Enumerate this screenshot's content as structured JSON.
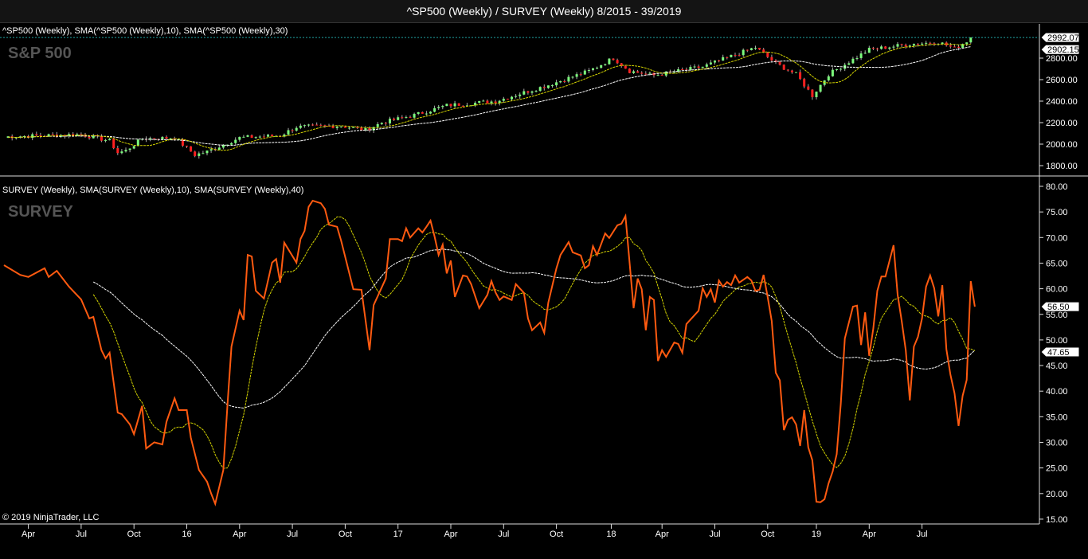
{
  "window_title": "^SP500 (Weekly) / SURVEY (Weekly)  8/2015 - 39/2019",
  "copyright": "© 2019 NinjaTrader, LLC",
  "chart_data": [
    {
      "type": "candlestick",
      "panel_header": "^SP500 (Weekly), SMA(^SP500 (Weekly),10), SMA(^SP500 (Weekly),30)",
      "panel_label": "S&P 500",
      "x_unit": "weeks since start",
      "y_ticks": [
        "1800.00",
        "2000.00",
        "2200.00",
        "2400.00",
        "2600.00",
        "2800.00"
      ],
      "y_tick_values": [
        1800,
        2000,
        2200,
        2400,
        2600,
        2800
      ],
      "ylim": [
        1720,
        3010
      ],
      "last_price_value": 2992.07,
      "last_price_label": "2992.07",
      "sma_value": 2902.15,
      "sma_label": "2902.15",
      "close_anchors": [
        [
          0,
          2060
        ],
        [
          1,
          2070
        ],
        [
          19,
          2090
        ],
        [
          26,
          2030
        ],
        [
          28,
          1920
        ],
        [
          30,
          1940
        ],
        [
          34,
          2050
        ],
        [
          42,
          2060
        ],
        [
          47,
          1900
        ],
        [
          50,
          1930
        ],
        [
          58,
          2060
        ],
        [
          68,
          2080
        ],
        [
          72,
          2160
        ],
        [
          83,
          2170
        ],
        [
          89,
          2130
        ],
        [
          93,
          2200
        ],
        [
          101,
          2270
        ],
        [
          109,
          2360
        ],
        [
          121,
          2400
        ],
        [
          134,
          2550
        ],
        [
          144,
          2680
        ],
        [
          150,
          2800
        ],
        [
          154,
          2680
        ],
        [
          160,
          2640
        ],
        [
          172,
          2720
        ],
        [
          185,
          2900
        ],
        [
          190,
          2750
        ],
        [
          195,
          2650
        ],
        [
          199,
          2450
        ],
        [
          203,
          2650
        ],
        [
          213,
          2880
        ],
        [
          223,
          2930
        ],
        [
          230,
          2950
        ],
        [
          234,
          2890
        ],
        [
          238,
          2980
        ]
      ],
      "sma_periods": [
        10,
        30
      ],
      "colors": {
        "up": "#7CFC7C",
        "down": "#ff2020",
        "sma10": "#d4d400",
        "sma30": "#ffffff",
        "price_line": "#20a0a0"
      }
    },
    {
      "type": "line",
      "panel_header": "SURVEY (Weekly), SMA(SURVEY (Weekly),10), SMA(SURVEY (Weekly),40)",
      "panel_label": "SURVEY",
      "x_unit": "weeks since start",
      "y_ticks": [
        "15.00",
        "20.00",
        "25.00",
        "30.00",
        "35.00",
        "40.00",
        "45.00",
        "50.00",
        "55.00",
        "60.00",
        "65.00",
        "70.00",
        "75.00",
        "80.00"
      ],
      "y_tick_values": [
        15,
        20,
        25,
        30,
        35,
        40,
        45,
        50,
        55,
        60,
        65,
        70,
        75,
        80
      ],
      "ylim": [
        15,
        80
      ],
      "last_value_label": "56.50",
      "last_value": 56.5,
      "sma_label": "47.65",
      "sma_value": 47.65,
      "sma_periods": [
        10,
        40
      ],
      "colors": {
        "line": "#ff5a10",
        "sma10": "#d4d400",
        "sma40": "#ffffff"
      },
      "points": [
        [
          0,
          64.6
        ],
        [
          4,
          62.7
        ],
        [
          6,
          62.3
        ],
        [
          10,
          64
        ],
        [
          11,
          62.3
        ],
        [
          13,
          63.5
        ],
        [
          16,
          60.4
        ],
        [
          19,
          57.9
        ],
        [
          21,
          54.2
        ],
        [
          22,
          54.5
        ],
        [
          24,
          48
        ],
        [
          25,
          46.4
        ],
        [
          26,
          47.5
        ],
        [
          28,
          35.8
        ],
        [
          29,
          35.5
        ],
        [
          31,
          33.5
        ],
        [
          32,
          31.6
        ],
        [
          34,
          37.1
        ],
        [
          35,
          28.8
        ],
        [
          37,
          30
        ],
        [
          39,
          29.6
        ],
        [
          40,
          34
        ],
        [
          42,
          38.6
        ],
        [
          43,
          36.3
        ],
        [
          45,
          36.3
        ],
        [
          46,
          30.9
        ],
        [
          48,
          24.6
        ],
        [
          50,
          22.3
        ],
        [
          51,
          20
        ],
        [
          52,
          18
        ],
        [
          54,
          24.6
        ],
        [
          55,
          37.1
        ],
        [
          56,
          48.7
        ],
        [
          58,
          55.7
        ],
        [
          59,
          53.9
        ],
        [
          60,
          66.6
        ],
        [
          61,
          66.3
        ],
        [
          62,
          59.6
        ],
        [
          64,
          58.1
        ],
        [
          66,
          65.1
        ],
        [
          67,
          65.8
        ],
        [
          68,
          61.2
        ],
        [
          69,
          69
        ],
        [
          72,
          65.1
        ],
        [
          73,
          69.7
        ],
        [
          74,
          71.3
        ],
        [
          75,
          76
        ],
        [
          76,
          77.2
        ],
        [
          78,
          76.7
        ],
        [
          79,
          75.6
        ],
        [
          80,
          72.5
        ],
        [
          82,
          72.1
        ],
        [
          83,
          69.4
        ],
        [
          86,
          59.9
        ],
        [
          88,
          59.8
        ],
        [
          90,
          48
        ],
        [
          91,
          56.8
        ],
        [
          94,
          62
        ],
        [
          95,
          69.7
        ],
        [
          97,
          69.7
        ],
        [
          98,
          69.3
        ],
        [
          99,
          71.8
        ],
        [
          100,
          70
        ],
        [
          102,
          71.8
        ],
        [
          103,
          71
        ],
        [
          104,
          72.1
        ],
        [
          105,
          73.3
        ],
        [
          106,
          70.2
        ],
        [
          107,
          66.6
        ],
        [
          108,
          68.6
        ],
        [
          109,
          63
        ],
        [
          110,
          65.5
        ],
        [
          111,
          58.4
        ],
        [
          113,
          62.6
        ],
        [
          114,
          62.4
        ],
        [
          115,
          60.9
        ],
        [
          117,
          56.2
        ],
        [
          119,
          58.8
        ],
        [
          120,
          61.5
        ],
        [
          121,
          59.3
        ],
        [
          122,
          57.8
        ],
        [
          123,
          58.5
        ],
        [
          125,
          57.8
        ],
        [
          126,
          60.9
        ],
        [
          128,
          59.2
        ],
        [
          129,
          54.2
        ],
        [
          130,
          51.9
        ],
        [
          132,
          53.4
        ],
        [
          133,
          51.4
        ],
        [
          134,
          57.3
        ],
        [
          136,
          64
        ],
        [
          137,
          66.6
        ],
        [
          139,
          69.1
        ],
        [
          140,
          67.1
        ],
        [
          142,
          66.5
        ],
        [
          143,
          64
        ],
        [
          144,
          64.6
        ],
        [
          145,
          68.3
        ],
        [
          146,
          66.6
        ],
        [
          148,
          70.8
        ],
        [
          149,
          69.9
        ],
        [
          151,
          72.4
        ],
        [
          152,
          72.7
        ],
        [
          153,
          74.2
        ],
        [
          155,
          56.2
        ],
        [
          156,
          62
        ],
        [
          157,
          59.9
        ],
        [
          158,
          51.9
        ],
        [
          159,
          58.4
        ],
        [
          160,
          57.8
        ],
        [
          161,
          45.9
        ],
        [
          162,
          48
        ],
        [
          163,
          46.7
        ],
        [
          165,
          49.5
        ],
        [
          166,
          49.2
        ],
        [
          167,
          47.5
        ],
        [
          168,
          53.1
        ],
        [
          171,
          55.7
        ],
        [
          172,
          60.1
        ],
        [
          173,
          58.4
        ],
        [
          174,
          59.9
        ],
        [
          175,
          57.3
        ],
        [
          176,
          61.6
        ],
        [
          177,
          60.4
        ],
        [
          178,
          61.3
        ],
        [
          179,
          60.7
        ],
        [
          180,
          62.6
        ],
        [
          181,
          61.2
        ],
        [
          183,
          62.3
        ],
        [
          184,
          61.6
        ],
        [
          185,
          59.6
        ],
        [
          186,
          59.8
        ],
        [
          187,
          62.7
        ],
        [
          188,
          58.4
        ],
        [
          189,
          53.7
        ],
        [
          190,
          43.6
        ],
        [
          191,
          42.1
        ],
        [
          192,
          32.4
        ],
        [
          193,
          34.4
        ],
        [
          194,
          34.9
        ],
        [
          195,
          33.5
        ],
        [
          196,
          29.3
        ],
        [
          197,
          36.3
        ],
        [
          198,
          29
        ],
        [
          199,
          26.5
        ],
        [
          200,
          18.4
        ],
        [
          201,
          18.3
        ],
        [
          202,
          18.9
        ],
        [
          203,
          22
        ],
        [
          204,
          24.3
        ],
        [
          205,
          27.7
        ],
        [
          206,
          37.5
        ],
        [
          207,
          50.3
        ],
        [
          209,
          56.5
        ],
        [
          210,
          56.7
        ],
        [
          211,
          49
        ],
        [
          212,
          55.4
        ],
        [
          213,
          46.9
        ],
        [
          214,
          52.2
        ],
        [
          215,
          59.6
        ],
        [
          216,
          62.4
        ],
        [
          217,
          62.4
        ],
        [
          219,
          68.5
        ],
        [
          220,
          58.8
        ],
        [
          221,
          53.7
        ],
        [
          222,
          48
        ],
        [
          223,
          38.2
        ],
        [
          224,
          48.7
        ],
        [
          225,
          50.6
        ],
        [
          226,
          54.2
        ],
        [
          227,
          60.4
        ],
        [
          228,
          62.6
        ],
        [
          229,
          60.1
        ],
        [
          230,
          54.6
        ],
        [
          231,
          60.7
        ],
        [
          232,
          48.2
        ],
        [
          233,
          43.2
        ],
        [
          234,
          39.6
        ],
        [
          235,
          33.2
        ],
        [
          236,
          39.1
        ],
        [
          237,
          42.2
        ],
        [
          238,
          61.5
        ],
        [
          239,
          56.5
        ]
      ]
    }
  ],
  "x_axis": {
    "labels": [
      "Apr",
      "Jul",
      "Oct",
      "16",
      "Apr",
      "Jul",
      "Oct",
      "17",
      "Apr",
      "Jul",
      "Oct",
      "18",
      "Apr",
      "Jul",
      "Oct",
      "19",
      "Apr",
      "Jul"
    ],
    "weeks": [
      6,
      19,
      32,
      45,
      58,
      71,
      84,
      97,
      110,
      123,
      136,
      149.5,
      162,
      175,
      188,
      200,
      213,
      226
    ]
  }
}
